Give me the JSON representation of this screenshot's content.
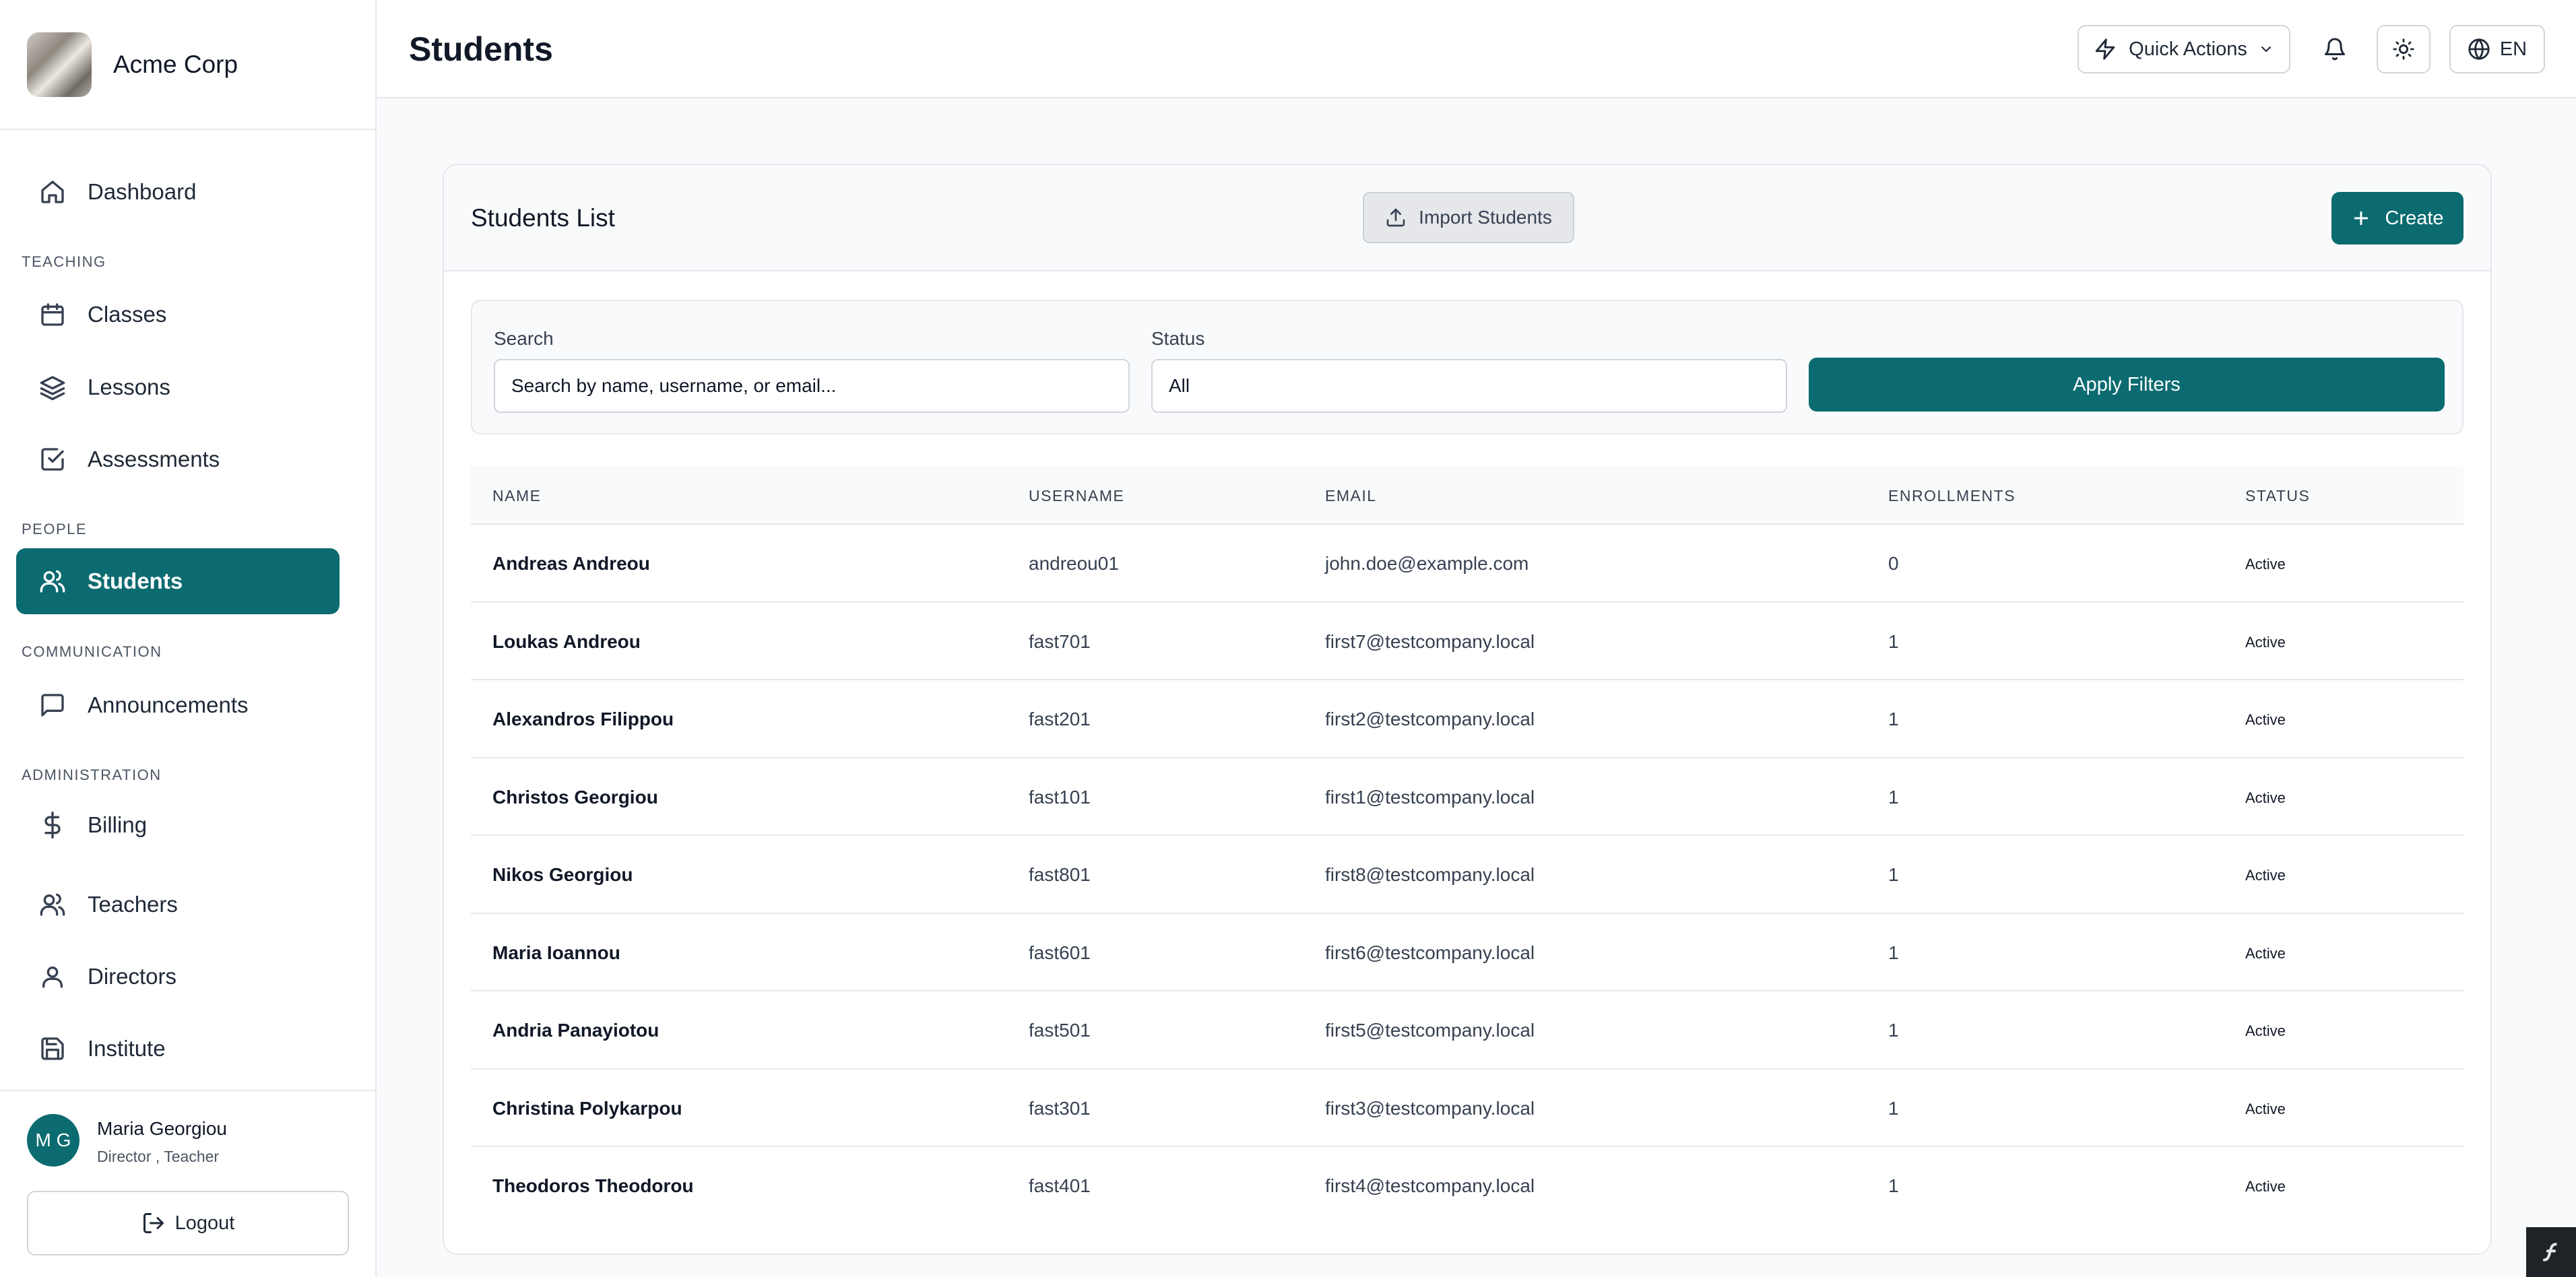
{
  "brand": {
    "name": "Acme Corp"
  },
  "sidebar": {
    "dashboard": "Dashboard",
    "sections": {
      "teaching": "TEACHING",
      "people": "PEOPLE",
      "communication": "COMMUNICATION",
      "administration": "ADMINISTRATION"
    },
    "items": {
      "classes": "Classes",
      "lessons": "Lessons",
      "assessments": "Assessments",
      "students": "Students",
      "announcements": "Announcements",
      "billing": "Billing",
      "teachers": "Teachers",
      "directors": "Directors",
      "institute": "Institute"
    },
    "active_item": "students"
  },
  "user": {
    "initials": "M G",
    "name": "Maria Georgiou",
    "roles": "Director , Teacher",
    "logout_label": "Logout"
  },
  "header": {
    "title": "Students",
    "quick_actions": "Quick Actions",
    "language": "EN"
  },
  "card": {
    "title": "Students List",
    "import_label": "Import Students",
    "create_label": "Create"
  },
  "filters": {
    "search_label": "Search",
    "search_placeholder": "Search by name, username, or email...",
    "status_label": "Status",
    "status_value": "All",
    "apply_label": "Apply Filters"
  },
  "table": {
    "headers": {
      "name": "NAME",
      "username": "USERNAME",
      "email": "EMAIL",
      "enrollments": "ENROLLMENTS",
      "status": "STATUS"
    },
    "rows": [
      {
        "name": "Andreas Andreou",
        "username": "andreou01",
        "email": "john.doe@example.com",
        "enrollments": "0",
        "status": "Active"
      },
      {
        "name": "Loukas Andreou",
        "username": "fast701",
        "email": "first7@testcompany.local",
        "enrollments": "1",
        "status": "Active"
      },
      {
        "name": "Alexandros Filippou",
        "username": "fast201",
        "email": "first2@testcompany.local",
        "enrollments": "1",
        "status": "Active"
      },
      {
        "name": "Christos Georgiou",
        "username": "fast101",
        "email": "first1@testcompany.local",
        "enrollments": "1",
        "status": "Active"
      },
      {
        "name": "Nikos Georgiou",
        "username": "fast801",
        "email": "first8@testcompany.local",
        "enrollments": "1",
        "status": "Active"
      },
      {
        "name": "Maria Ioannou",
        "username": "fast601",
        "email": "first6@testcompany.local",
        "enrollments": "1",
        "status": "Active"
      },
      {
        "name": "Andria Panayiotou",
        "username": "fast501",
        "email": "first5@testcompany.local",
        "enrollments": "1",
        "status": "Active"
      },
      {
        "name": "Christina Polykarpou",
        "username": "fast301",
        "email": "first3@testcompany.local",
        "enrollments": "1",
        "status": "Active"
      },
      {
        "name": "Theodoros Theodorou",
        "username": "fast401",
        "email": "first4@testcompany.local",
        "enrollments": "1",
        "status": "Active"
      }
    ]
  },
  "colors": {
    "accent": "#0b6b70",
    "border": "#e5e7eb",
    "background": "#f9fafb"
  },
  "icons": {
    "dashboard": "home-icon",
    "classes": "calendar-icon",
    "lessons": "layers-icon",
    "assessments": "checkbox-icon",
    "students": "users-icon",
    "announcements": "message-square-icon",
    "billing": "dollar-icon",
    "teachers": "users-icon",
    "directors": "user-icon",
    "institute": "save-icon",
    "logout": "logout-icon",
    "quick_actions": "lightning-icon",
    "notifications": "bell-icon",
    "theme": "sun-icon",
    "language": "globe-icon",
    "import": "upload-icon",
    "create": "plus-icon"
  }
}
